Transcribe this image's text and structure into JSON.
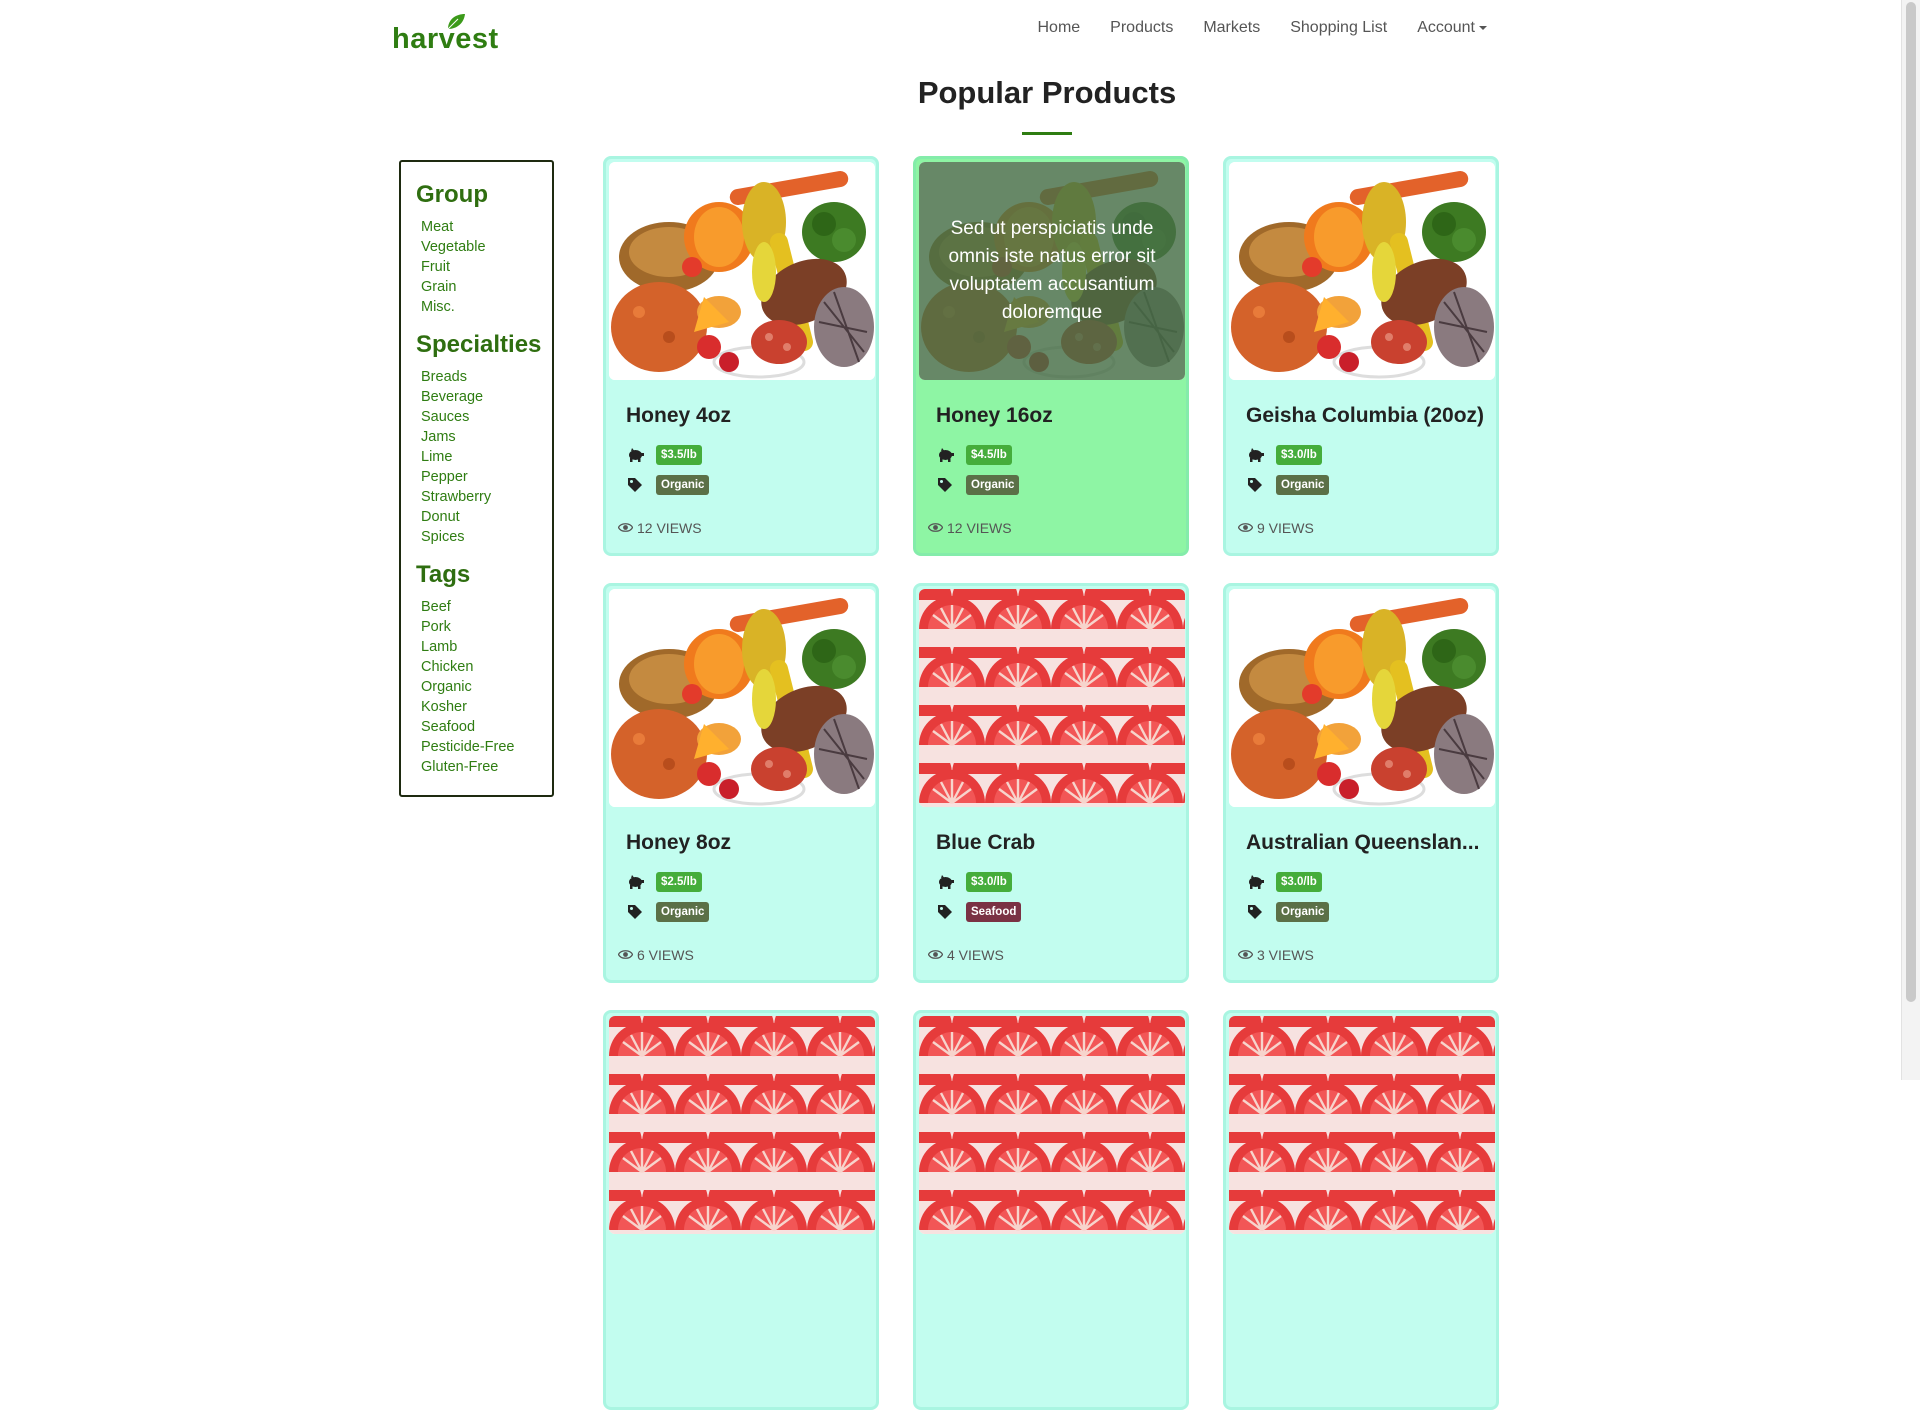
{
  "brand": {
    "logo_text": "harvest"
  },
  "nav": {
    "items": [
      {
        "label": "Home"
      },
      {
        "label": "Products"
      },
      {
        "label": "Markets"
      },
      {
        "label": "Shopping List"
      },
      {
        "label": "Account"
      }
    ]
  },
  "page": {
    "title": "Popular Products"
  },
  "sidebar": {
    "sections": [
      {
        "heading": "Group",
        "items": [
          "Meat",
          "Vegetable",
          "Fruit",
          "Grain",
          "Misc."
        ]
      },
      {
        "heading": "Specialties",
        "items": [
          "Breads",
          "Beverage",
          "Sauces",
          "Jams",
          "Lime",
          "Pepper",
          "Strawberry",
          "Donut",
          "Spices"
        ]
      },
      {
        "heading": "Tags",
        "items": [
          "Beef",
          "Pork",
          "Lamb",
          "Chicken",
          "Organic",
          "Kosher",
          "Seafood",
          "Pesticide-Free",
          "Gluten-Free"
        ]
      }
    ]
  },
  "products": [
    {
      "title": "Honey 4oz",
      "price": "$3.5/lb",
      "tag": "Organic",
      "views": "12 VIEWS",
      "image": "vegetables-image",
      "hover_text": ""
    },
    {
      "title": "Honey 16oz",
      "price": "$4.5/lb",
      "tag": "Organic",
      "views": "12 VIEWS",
      "image": "vegetables-image",
      "hover_text": "Sed ut perspiciatis unde omnis iste natus error sit voluptatem accusantium doloremque"
    },
    {
      "title": "Geisha Columbia (20oz)",
      "price": "$3.0/lb",
      "tag": "Organic",
      "views": "9 VIEWS",
      "image": "vegetables-image",
      "hover_text": ""
    },
    {
      "title": "Honey 8oz",
      "price": "$2.5/lb",
      "tag": "Organic",
      "views": "6 VIEWS",
      "image": "vegetables-image",
      "hover_text": ""
    },
    {
      "title": "Blue Crab",
      "price": "$3.0/lb",
      "tag": "Seafood",
      "views": "4 VIEWS",
      "image": "grapefruit-image",
      "hover_text": ""
    },
    {
      "title": "Australian Queenslan...",
      "price": "$3.0/lb",
      "tag": "Organic",
      "views": "3 VIEWS",
      "image": "vegetables-image",
      "hover_text": ""
    }
  ],
  "colors": {
    "brand_green": "#2f7d12",
    "card_bg": "#c2fdef",
    "card_hover_bg": "#8ef5a4",
    "price_badge": "#45ad3b",
    "organic_badge": "#5b7047",
    "seafood_badge": "#7a3244"
  },
  "icons": {
    "price": "piggy-bank-icon",
    "tag": "tag-icon",
    "views": "eye-icon"
  }
}
